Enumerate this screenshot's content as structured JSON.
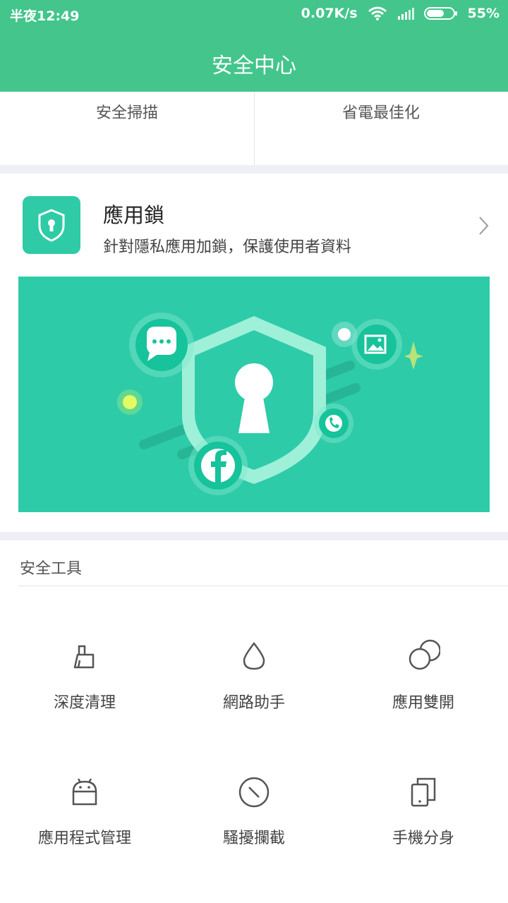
{
  "status_bar": {
    "time": "半夜12:49",
    "net_speed": "0.07K/s",
    "battery": "55%"
  },
  "header": {
    "title": "安全中心"
  },
  "top_tabs": [
    {
      "label": "安全掃描"
    },
    {
      "label": "省電最佳化"
    }
  ],
  "applock": {
    "title": "應用鎖",
    "subtitle": "針對隱私應用加鎖，保護使用者資料"
  },
  "tools": {
    "title": "安全工具",
    "items": [
      {
        "label": "深度清理",
        "icon": "broom-icon"
      },
      {
        "label": "網路助手",
        "icon": "drop-icon"
      },
      {
        "label": "應用雙開",
        "icon": "dual-circle-icon"
      },
      {
        "label": "應用程式管理",
        "icon": "android-icon"
      },
      {
        "label": "騷擾攔截",
        "icon": "block-icon"
      },
      {
        "label": "手機分身",
        "icon": "dual-phone-icon"
      }
    ]
  },
  "colors": {
    "accent": "#43c58c",
    "banner": "#2ecba9"
  }
}
